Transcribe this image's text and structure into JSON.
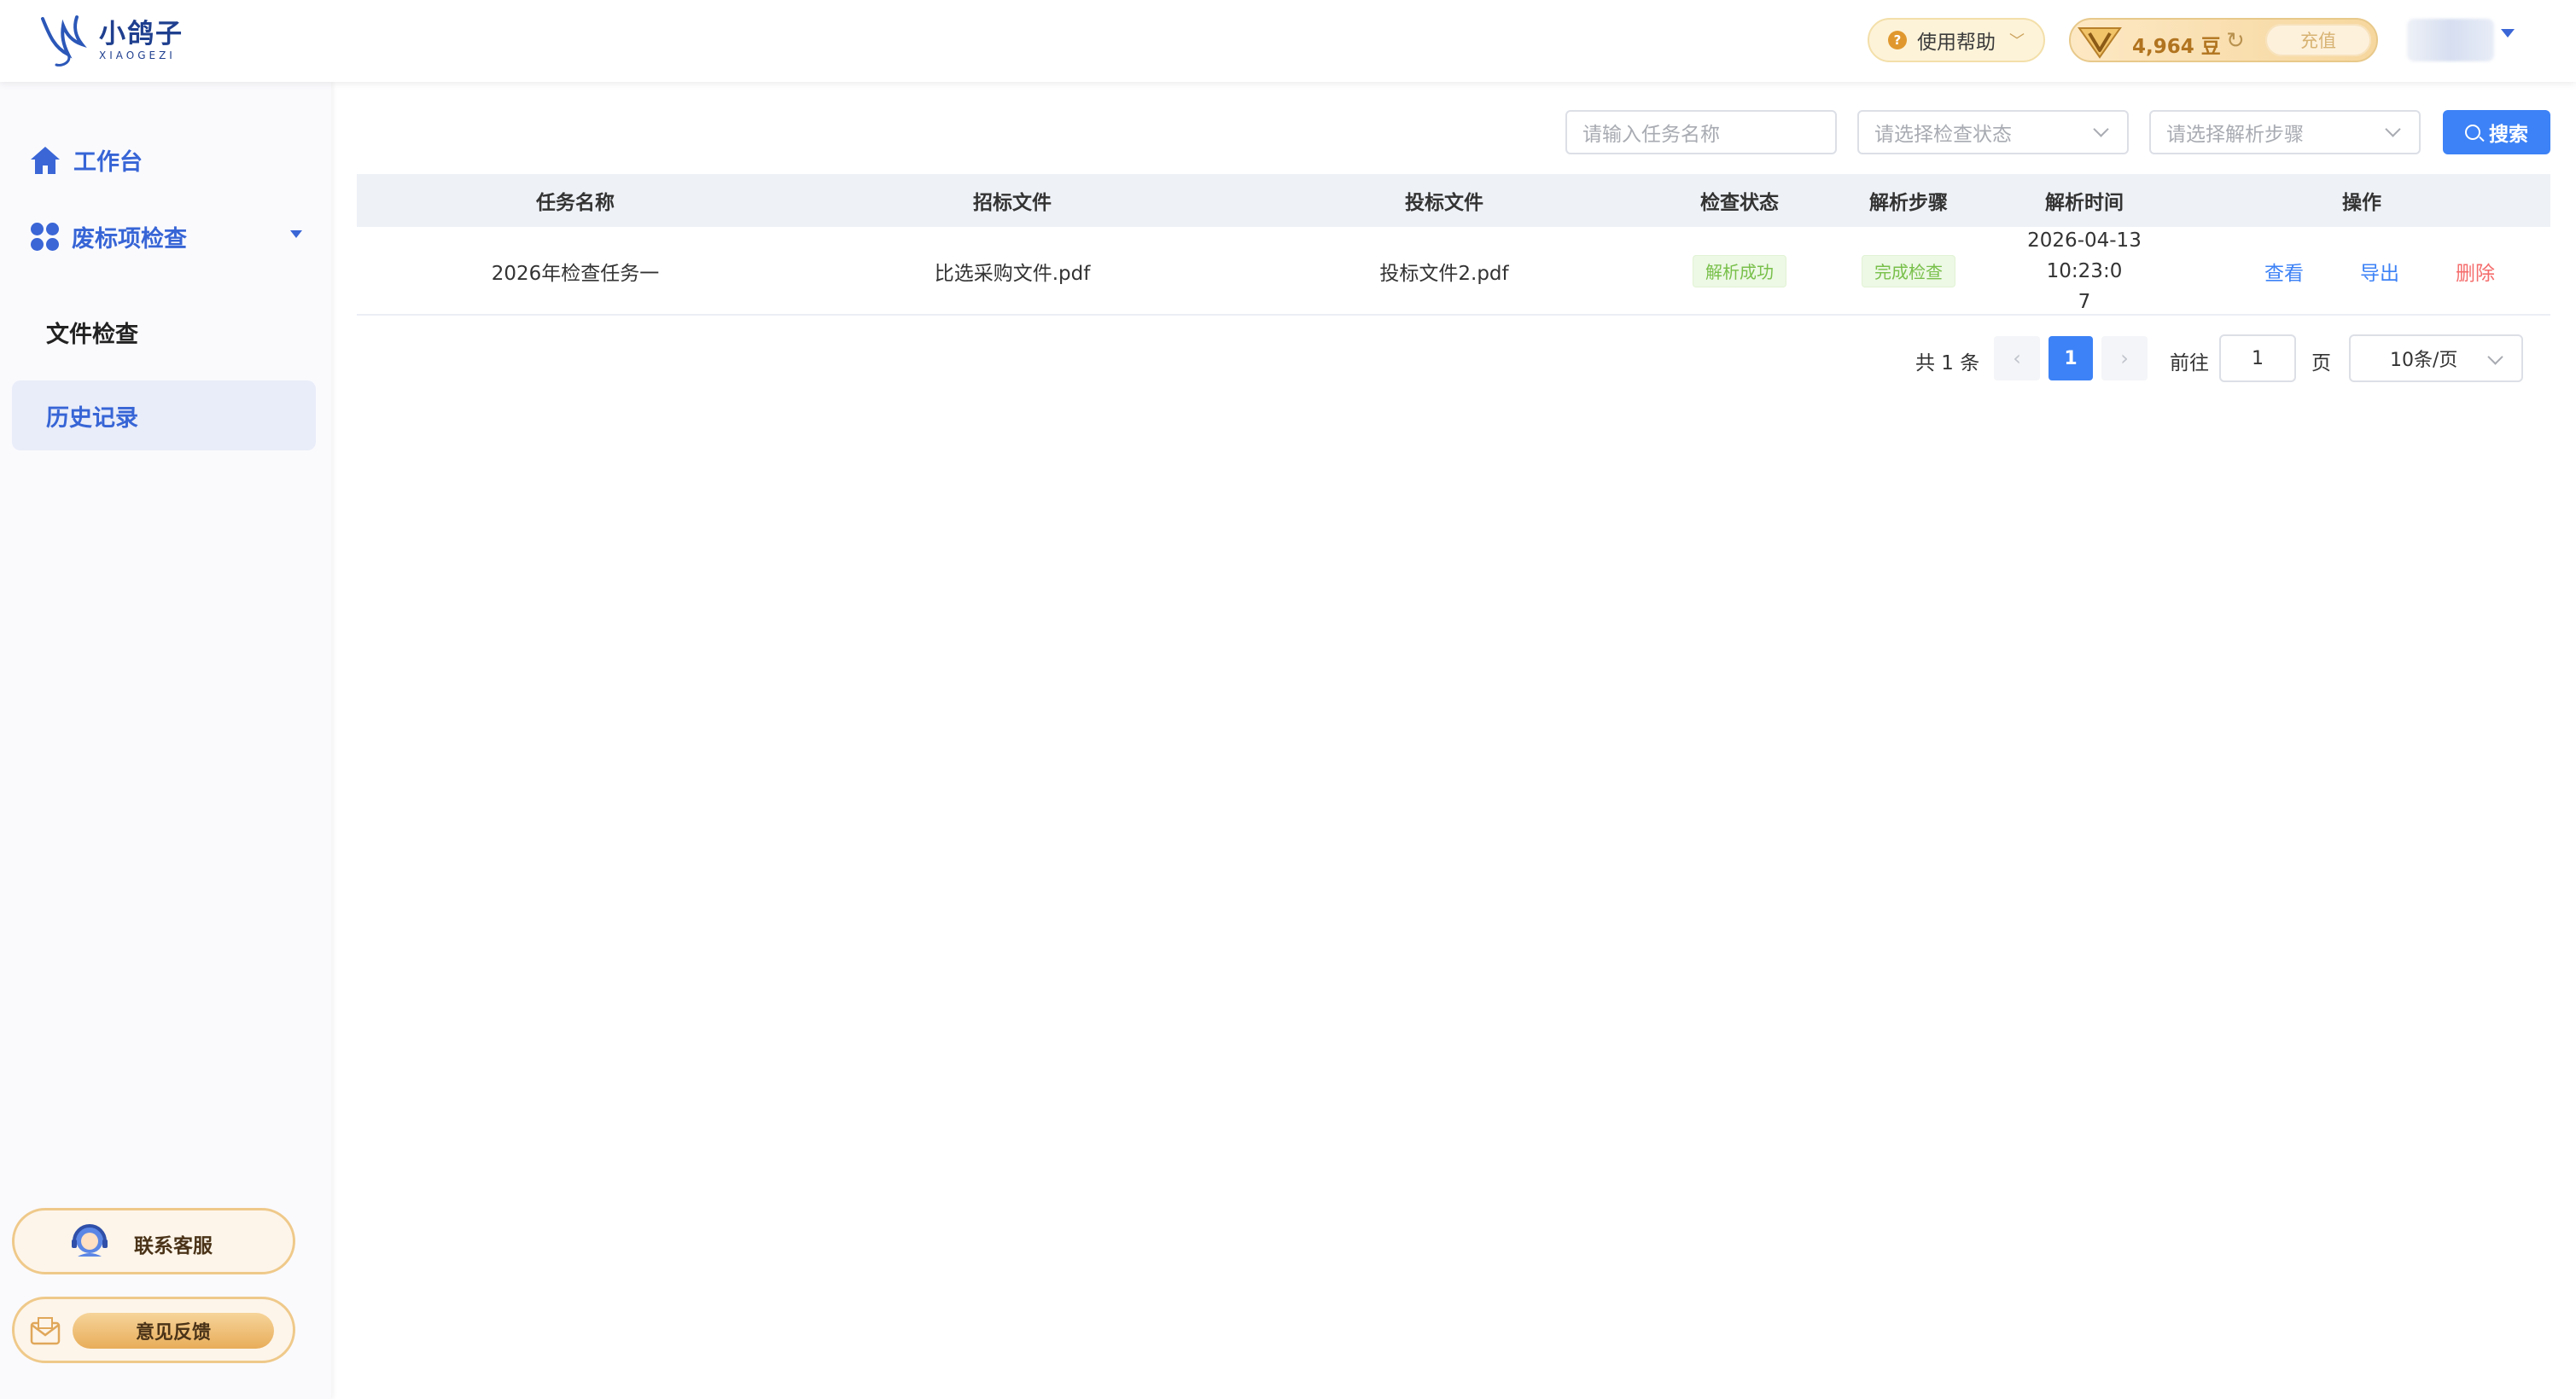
{
  "brand": {
    "name_cn": "小鸽子",
    "name_en": "XIAOGEZI"
  },
  "header": {
    "help_label": "使用帮助",
    "coins": "4,964 豆",
    "recharge_label": "充值"
  },
  "sidebar": {
    "home_label": "工作台",
    "group_label": "废标项检查",
    "items": [
      {
        "label": "文件检查",
        "active": false
      },
      {
        "label": "历史记录",
        "active": true
      }
    ],
    "service_label": "联系客服",
    "feedback_label": "意见反馈"
  },
  "filters": {
    "name_placeholder": "请输入任务名称",
    "status_placeholder": "请选择检查状态",
    "step_placeholder": "请选择解析步骤",
    "search_label": "搜索"
  },
  "table": {
    "columns": [
      "任务名称",
      "招标文件",
      "投标文件",
      "检查状态",
      "解析步骤",
      "解析时间",
      "操作"
    ],
    "rows": [
      {
        "task_name": "2026年检查任务一",
        "tender_file": "比选采购文件.pdf",
        "bid_file": "投标文件2.pdf",
        "check_status": "解析成功",
        "parse_step": "完成检查",
        "parse_time_line1": "2026-04-13 10:23:0",
        "parse_time_line2": "7",
        "actions": {
          "view": "查看",
          "export": "导出",
          "delete": "删除"
        }
      }
    ]
  },
  "pagination": {
    "total_text": "共 1 条",
    "current_page": "1",
    "goto_label": "前往",
    "goto_value": "1",
    "page_suffix": "页",
    "page_size": "10条/页"
  },
  "colors": {
    "primary": "#3d82f6",
    "danger": "#f56c6c",
    "success": "#78c04a",
    "accent_gold": "#efc98a"
  }
}
